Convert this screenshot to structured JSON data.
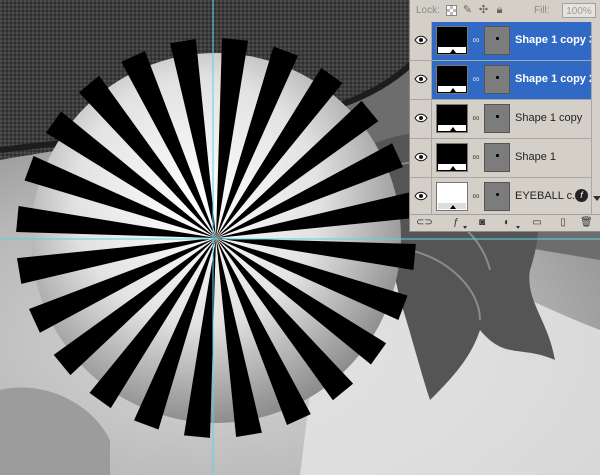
{
  "layers_panel": {
    "lock_label": "Lock:",
    "fill_label": "Fill:",
    "fill_value": "100%",
    "layers": [
      {
        "name": "Shape 1 copy 3",
        "selected": true,
        "visible": true,
        "thumb": "black"
      },
      {
        "name": "Shape 1 copy 2",
        "selected": true,
        "visible": true,
        "thumb": "black"
      },
      {
        "name": "Shape 1 copy",
        "selected": false,
        "visible": true,
        "thumb": "black"
      },
      {
        "name": "Shape 1",
        "selected": false,
        "visible": true,
        "thumb": "black"
      },
      {
        "name": "EYEBALL c...",
        "selected": false,
        "visible": true,
        "thumb": "white",
        "has_fx": true
      }
    ],
    "footer_icons": [
      "link-layers-icon",
      "fx-icon",
      "add-mask-icon",
      "adjustment-layer-icon",
      "new-group-icon",
      "new-layer-icon",
      "delete-layer-icon"
    ]
  },
  "colors": {
    "selection": "#316ac5",
    "panel_bg": "#d4d0c8",
    "guide": "#5ad2e6"
  }
}
